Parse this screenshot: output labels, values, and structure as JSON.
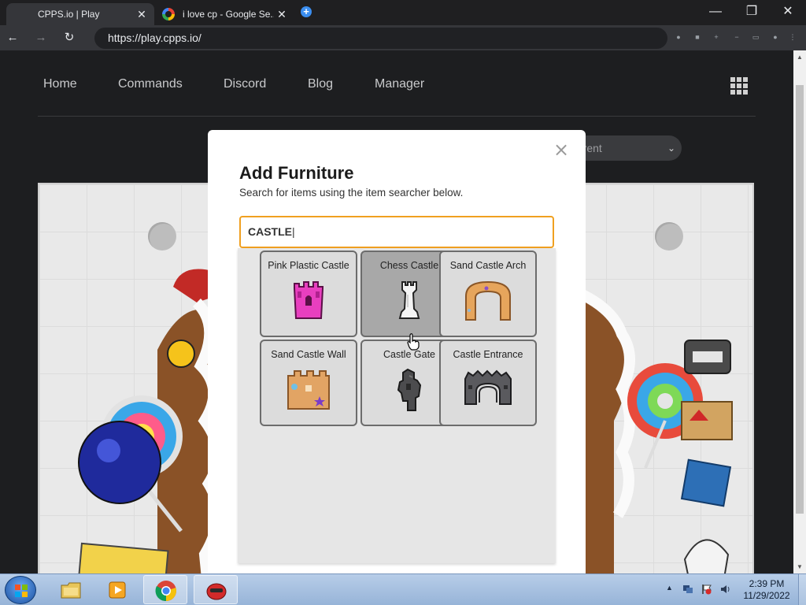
{
  "browser": {
    "tabs": [
      {
        "title": "CPPS.io | Play",
        "close": "✕"
      },
      {
        "title": "i love cp - Google Se...",
        "close": "✕"
      }
    ],
    "new_tab": "+",
    "window_controls": {
      "minimize": "—",
      "maximize": "❐",
      "close": "✕"
    },
    "nav": {
      "back": "←",
      "forward": "→",
      "reload": "↻"
    },
    "url": "https://play.cpps.io/"
  },
  "site_nav": {
    "links": [
      "Home",
      "Commands",
      "Discord",
      "Blog",
      "Manager"
    ],
    "apps_icon": "grid-icon"
  },
  "selector": {
    "visible_text": "rrent",
    "chevron": "⌄"
  },
  "modal": {
    "close": "×",
    "title": "Add Furniture",
    "subtitle": "Search for items using the item searcher below.",
    "search_value": "CASTLE",
    "items": [
      {
        "label": "Pink Plastic Castle",
        "icon": "pink-castle-icon"
      },
      {
        "label": "Chess Castle",
        "icon": "chess-rook-icon"
      },
      {
        "label": "Sand Castle Arch",
        "icon": "sand-arch-icon"
      },
      {
        "label": "Sand Castle Wall",
        "icon": "sand-wall-icon"
      },
      {
        "label": "Castle Gate",
        "icon": "castle-gate-icon"
      },
      {
        "label": "Castle Entrance",
        "icon": "castle-entrance-icon"
      }
    ]
  },
  "taskbar": {
    "apps": [
      "file-explorer-icon",
      "media-player-icon",
      "chrome-icon",
      "game-client-icon"
    ],
    "clock_time": "2:39 PM",
    "clock_date": "11/29/2022",
    "tray_expand": "▲"
  },
  "colors": {
    "search_border": "#f0a020",
    "page_bg": "#1d1e20",
    "tile_hover": "#a8a8a8"
  }
}
